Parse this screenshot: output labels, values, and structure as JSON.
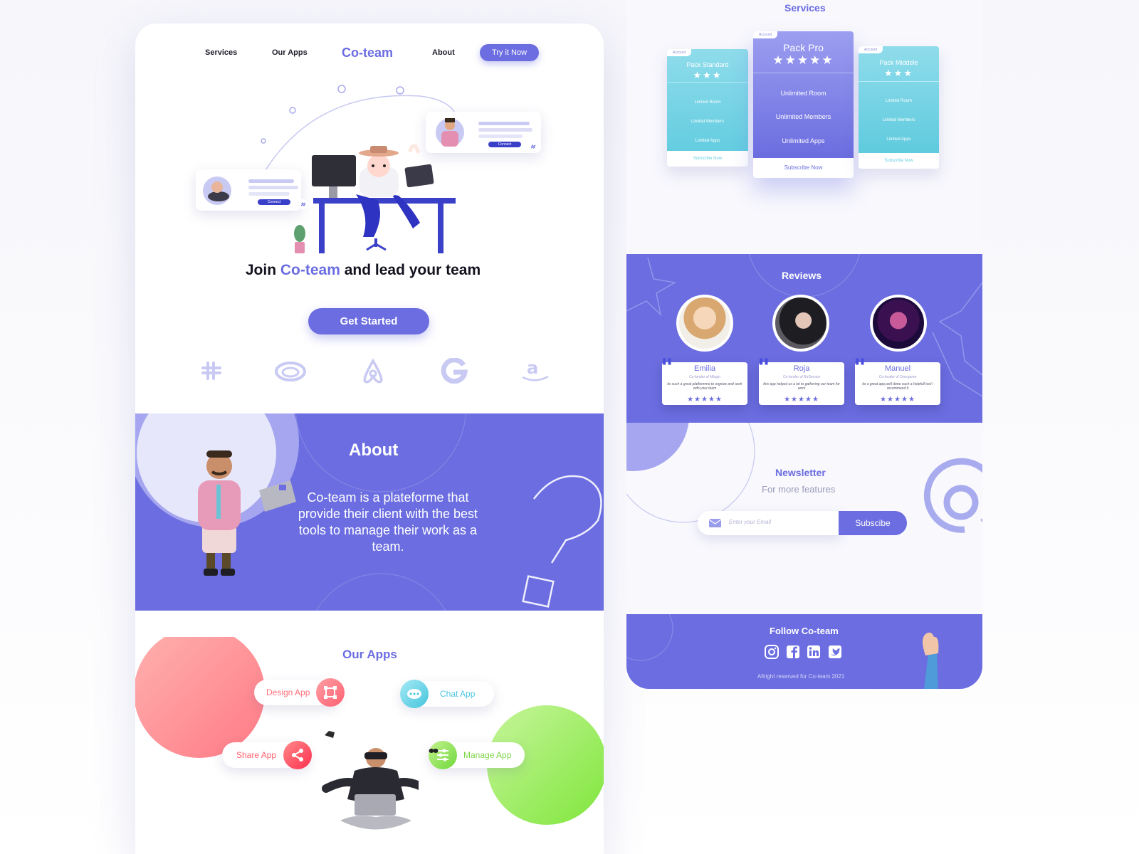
{
  "colors": {
    "accent": "#6b6de0",
    "coral": "#ff8a8a",
    "lime": "#94e84e",
    "cyan": "#67d3e6"
  },
  "nav": {
    "links": [
      "Services",
      "Our Apps",
      "About"
    ],
    "brand": "Co-team",
    "cta": "Try it Now"
  },
  "hero": {
    "title_pre": "Join ",
    "title_accent": "Co-team",
    "title_post": " and lead your team",
    "cta": "Get Started",
    "card_button": "Connect"
  },
  "partners": [
    "slack-icon",
    "creative-cloud-icon",
    "airbnb-icon",
    "google-icon",
    "amazon-icon"
  ],
  "about": {
    "title": "About",
    "text": "Co-team is a plateforme that provide their client with  the best tools to manage their work as a team."
  },
  "apps": {
    "title": "Our Apps",
    "items": [
      {
        "label": "Design App",
        "icon": "design-frame-icon"
      },
      {
        "label": "Chat App",
        "icon": "chat-bubble-icon"
      },
      {
        "label": "Share App",
        "icon": "share-icon"
      },
      {
        "label": "Manage App",
        "icon": "sliders-icon"
      }
    ]
  },
  "services": {
    "title": "Services",
    "tab": "Account",
    "plans": [
      {
        "name": "Pack Standard",
        "stars": 3,
        "features": [
          "Limited Room",
          "Limited Members",
          "Limited Apps"
        ],
        "cta": "Subscribe Now"
      },
      {
        "name": "Pack Pro",
        "stars": 5,
        "features": [
          "Unlimited Room",
          "Unlimited Members",
          "Unlimited Apps"
        ],
        "cta": "Subscribe Now"
      },
      {
        "name": "Pack Middele",
        "stars": 3,
        "features": [
          "Limited Room",
          "Limited Members",
          "Limited Apps"
        ],
        "cta": "Subscribe Now"
      }
    ]
  },
  "reviews": {
    "title": "Reviews",
    "items": [
      {
        "name": "Emilia",
        "role": "Co-fonder of Mlogin",
        "text": "its such a great platformme to orgnize and work with your team",
        "stars": 5
      },
      {
        "name": "Roja",
        "role": "Co-fonder of RoService",
        "text": "this app helped us a lot to gathering our team for work",
        "stars": 5
      },
      {
        "name": "Manuel",
        "role": "Co-fonder of Overgame",
        "text": "its a great app,well done such a helpfull tool i recommend it",
        "stars": 5
      }
    ]
  },
  "newsletter": {
    "title": "Newsletter",
    "subtitle": "For more features",
    "placeholder": "Enter your Email",
    "button": "Subscibe"
  },
  "footer": {
    "title": "Follow Co-team",
    "socials": [
      "instagram-icon",
      "facebook-icon",
      "linkedin-icon",
      "twitter-icon"
    ],
    "rights": "Allright reserved for Co-team 2021"
  }
}
